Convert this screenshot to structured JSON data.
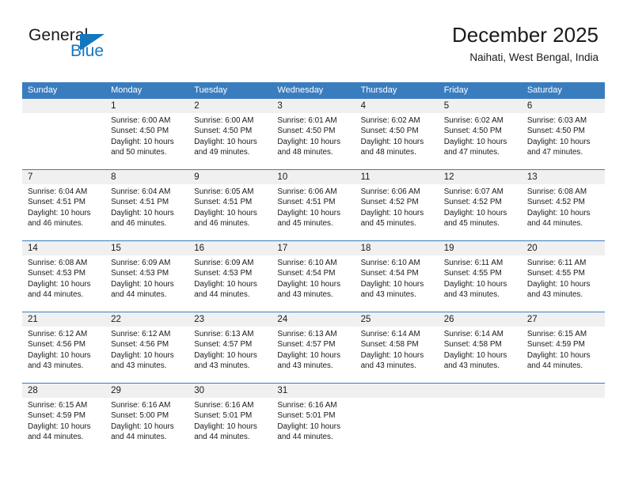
{
  "logo": {
    "word_top": "General",
    "word_bottom": "Blue",
    "triangle": "blue-triangle-icon",
    "accent_color": "#1277bf"
  },
  "header": {
    "title": "December 2025",
    "subtitle": "Naihati, West Bengal, India"
  },
  "theme": {
    "header_row_bg": "#3a7dbf",
    "daynum_row_bg": "#f0f0f0",
    "text_color": "#1a1a1a"
  },
  "calendar": {
    "day_headers": [
      "Sunday",
      "Monday",
      "Tuesday",
      "Wednesday",
      "Thursday",
      "Friday",
      "Saturday"
    ],
    "weeks": [
      [
        {
          "day": "",
          "lines": []
        },
        {
          "day": "1",
          "lines": [
            "Sunrise: 6:00 AM",
            "Sunset: 4:50 PM",
            "Daylight: 10 hours",
            "and 50 minutes."
          ]
        },
        {
          "day": "2",
          "lines": [
            "Sunrise: 6:00 AM",
            "Sunset: 4:50 PM",
            "Daylight: 10 hours",
            "and 49 minutes."
          ]
        },
        {
          "day": "3",
          "lines": [
            "Sunrise: 6:01 AM",
            "Sunset: 4:50 PM",
            "Daylight: 10 hours",
            "and 48 minutes."
          ]
        },
        {
          "day": "4",
          "lines": [
            "Sunrise: 6:02 AM",
            "Sunset: 4:50 PM",
            "Daylight: 10 hours",
            "and 48 minutes."
          ]
        },
        {
          "day": "5",
          "lines": [
            "Sunrise: 6:02 AM",
            "Sunset: 4:50 PM",
            "Daylight: 10 hours",
            "and 47 minutes."
          ]
        },
        {
          "day": "6",
          "lines": [
            "Sunrise: 6:03 AM",
            "Sunset: 4:50 PM",
            "Daylight: 10 hours",
            "and 47 minutes."
          ]
        }
      ],
      [
        {
          "day": "7",
          "lines": [
            "Sunrise: 6:04 AM",
            "Sunset: 4:51 PM",
            "Daylight: 10 hours",
            "and 46 minutes."
          ]
        },
        {
          "day": "8",
          "lines": [
            "Sunrise: 6:04 AM",
            "Sunset: 4:51 PM",
            "Daylight: 10 hours",
            "and 46 minutes."
          ]
        },
        {
          "day": "9",
          "lines": [
            "Sunrise: 6:05 AM",
            "Sunset: 4:51 PM",
            "Daylight: 10 hours",
            "and 46 minutes."
          ]
        },
        {
          "day": "10",
          "lines": [
            "Sunrise: 6:06 AM",
            "Sunset: 4:51 PM",
            "Daylight: 10 hours",
            "and 45 minutes."
          ]
        },
        {
          "day": "11",
          "lines": [
            "Sunrise: 6:06 AM",
            "Sunset: 4:52 PM",
            "Daylight: 10 hours",
            "and 45 minutes."
          ]
        },
        {
          "day": "12",
          "lines": [
            "Sunrise: 6:07 AM",
            "Sunset: 4:52 PM",
            "Daylight: 10 hours",
            "and 45 minutes."
          ]
        },
        {
          "day": "13",
          "lines": [
            "Sunrise: 6:08 AM",
            "Sunset: 4:52 PM",
            "Daylight: 10 hours",
            "and 44 minutes."
          ]
        }
      ],
      [
        {
          "day": "14",
          "lines": [
            "Sunrise: 6:08 AM",
            "Sunset: 4:53 PM",
            "Daylight: 10 hours",
            "and 44 minutes."
          ]
        },
        {
          "day": "15",
          "lines": [
            "Sunrise: 6:09 AM",
            "Sunset: 4:53 PM",
            "Daylight: 10 hours",
            "and 44 minutes."
          ]
        },
        {
          "day": "16",
          "lines": [
            "Sunrise: 6:09 AM",
            "Sunset: 4:53 PM",
            "Daylight: 10 hours",
            "and 44 minutes."
          ]
        },
        {
          "day": "17",
          "lines": [
            "Sunrise: 6:10 AM",
            "Sunset: 4:54 PM",
            "Daylight: 10 hours",
            "and 43 minutes."
          ]
        },
        {
          "day": "18",
          "lines": [
            "Sunrise: 6:10 AM",
            "Sunset: 4:54 PM",
            "Daylight: 10 hours",
            "and 43 minutes."
          ]
        },
        {
          "day": "19",
          "lines": [
            "Sunrise: 6:11 AM",
            "Sunset: 4:55 PM",
            "Daylight: 10 hours",
            "and 43 minutes."
          ]
        },
        {
          "day": "20",
          "lines": [
            "Sunrise: 6:11 AM",
            "Sunset: 4:55 PM",
            "Daylight: 10 hours",
            "and 43 minutes."
          ]
        }
      ],
      [
        {
          "day": "21",
          "lines": [
            "Sunrise: 6:12 AM",
            "Sunset: 4:56 PM",
            "Daylight: 10 hours",
            "and 43 minutes."
          ]
        },
        {
          "day": "22",
          "lines": [
            "Sunrise: 6:12 AM",
            "Sunset: 4:56 PM",
            "Daylight: 10 hours",
            "and 43 minutes."
          ]
        },
        {
          "day": "23",
          "lines": [
            "Sunrise: 6:13 AM",
            "Sunset: 4:57 PM",
            "Daylight: 10 hours",
            "and 43 minutes."
          ]
        },
        {
          "day": "24",
          "lines": [
            "Sunrise: 6:13 AM",
            "Sunset: 4:57 PM",
            "Daylight: 10 hours",
            "and 43 minutes."
          ]
        },
        {
          "day": "25",
          "lines": [
            "Sunrise: 6:14 AM",
            "Sunset: 4:58 PM",
            "Daylight: 10 hours",
            "and 43 minutes."
          ]
        },
        {
          "day": "26",
          "lines": [
            "Sunrise: 6:14 AM",
            "Sunset: 4:58 PM",
            "Daylight: 10 hours",
            "and 43 minutes."
          ]
        },
        {
          "day": "27",
          "lines": [
            "Sunrise: 6:15 AM",
            "Sunset: 4:59 PM",
            "Daylight: 10 hours",
            "and 44 minutes."
          ]
        }
      ],
      [
        {
          "day": "28",
          "lines": [
            "Sunrise: 6:15 AM",
            "Sunset: 4:59 PM",
            "Daylight: 10 hours",
            "and 44 minutes."
          ]
        },
        {
          "day": "29",
          "lines": [
            "Sunrise: 6:16 AM",
            "Sunset: 5:00 PM",
            "Daylight: 10 hours",
            "and 44 minutes."
          ]
        },
        {
          "day": "30",
          "lines": [
            "Sunrise: 6:16 AM",
            "Sunset: 5:01 PM",
            "Daylight: 10 hours",
            "and 44 minutes."
          ]
        },
        {
          "day": "31",
          "lines": [
            "Sunrise: 6:16 AM",
            "Sunset: 5:01 PM",
            "Daylight: 10 hours",
            "and 44 minutes."
          ]
        },
        {
          "day": "",
          "lines": []
        },
        {
          "day": "",
          "lines": []
        },
        {
          "day": "",
          "lines": []
        }
      ]
    ]
  }
}
